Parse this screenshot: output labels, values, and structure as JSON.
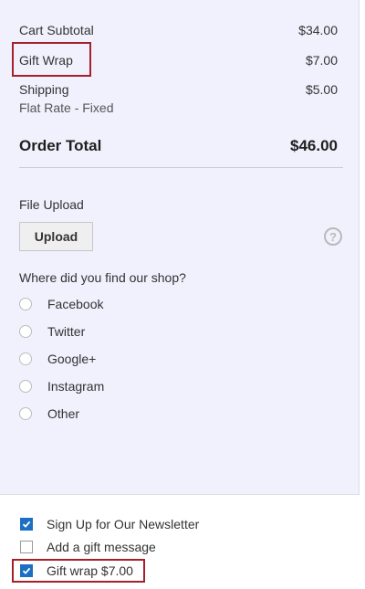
{
  "summary": {
    "cart_subtotal_label": "Cart Subtotal",
    "cart_subtotal_value": "$34.00",
    "gift_wrap_label": "Gift Wrap",
    "gift_wrap_value": "$7.00",
    "shipping_label": "Shipping",
    "shipping_value": "$5.00",
    "shipping_method": "Flat Rate - Fixed",
    "order_total_label": "Order Total",
    "order_total_value": "$46.00"
  },
  "upload": {
    "label": "File Upload",
    "button": "Upload",
    "help_glyph": "?"
  },
  "survey": {
    "question": "Where did you find our shop?",
    "options": [
      "Facebook",
      "Twitter",
      "Google+",
      "Instagram",
      "Other"
    ]
  },
  "options": {
    "newsletter": {
      "label": "Sign Up for Our Newsletter",
      "checked": true
    },
    "gift_message": {
      "label": "Add a gift message",
      "checked": false
    },
    "gift_wrap": {
      "label": "Gift wrap $7.00",
      "checked": true
    }
  },
  "colors": {
    "panel_bg": "#f0f1fd",
    "highlight": "#a6202b",
    "checkbox_on": "#1c6fc2"
  },
  "icons": {
    "help": "help-circle-icon",
    "check": "checkmark-icon"
  }
}
